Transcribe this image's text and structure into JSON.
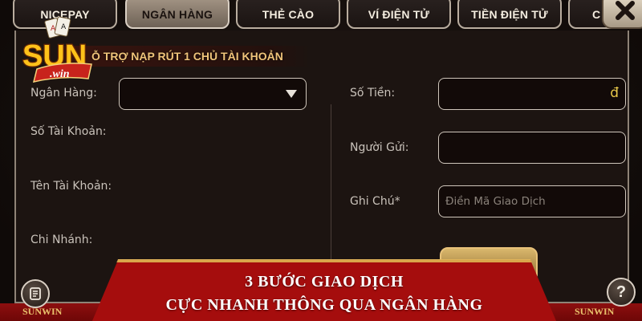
{
  "tabs": [
    {
      "label": "NICEPAY",
      "active": false
    },
    {
      "label": "NGÂN HÀNG",
      "active": true
    },
    {
      "label": "THẺ CÀO",
      "active": false
    },
    {
      "label": "VÍ ĐIỆN TỬ",
      "active": false
    },
    {
      "label": "TIỀN ĐIỆN TỬ",
      "active": false
    },
    {
      "label": "C",
      "active": false
    }
  ],
  "logo": {
    "brand_big": "SUN",
    "brand_small": ".win"
  },
  "support_banner": "Ỗ TRỢ NẠP RÚT 1 CHỦ TÀI KHOẢN",
  "form": {
    "bank_label": "Ngân Hàng:",
    "bank_value": "",
    "account_number_label": "Số Tài Khoản:",
    "account_name_label": "Tên Tài Khoản:",
    "branch_label": "Chi Nhánh:",
    "amount_label": "Số Tiền:",
    "amount_currency": "đ",
    "sender_label": "Người Gửi:",
    "sender_value": "",
    "note_label": "Ghi Chú*",
    "note_placeholder": "Điền Mã Giao Dịch"
  },
  "promo": {
    "line1": "3 BƯỚC GIAO DỊCH",
    "line2": "CỰC NHANH THÔNG QUA NGÂN HÀNG"
  },
  "footer": {
    "brand_left": "SUNWIN",
    "brand_right": "SUNWIN"
  },
  "help_glyph": "?",
  "colors": {
    "accent_gold": "#f0c47a",
    "promo_red": "#a50d0d",
    "active_tab": "#a59686"
  }
}
